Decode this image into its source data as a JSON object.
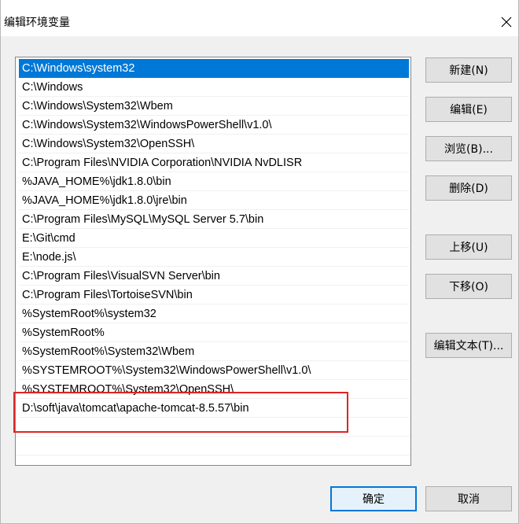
{
  "window": {
    "title": "编辑环境变量"
  },
  "path_list": {
    "items": [
      "C:\\Windows\\system32",
      "C:\\Windows",
      "C:\\Windows\\System32\\Wbem",
      "C:\\Windows\\System32\\WindowsPowerShell\\v1.0\\",
      "C:\\Windows\\System32\\OpenSSH\\",
      "C:\\Program Files\\NVIDIA Corporation\\NVIDIA NvDLISR",
      "%JAVA_HOME%\\jdk1.8.0\\bin",
      "%JAVA_HOME%\\jdk1.8.0\\jre\\bin",
      "C:\\Program Files\\MySQL\\MySQL Server 5.7\\bin",
      "E:\\Git\\cmd",
      "E:\\node.js\\",
      "C:\\Program Files\\VisualSVN Server\\bin",
      "C:\\Program Files\\TortoiseSVN\\bin",
      "%SystemRoot%\\system32",
      "%SystemRoot%",
      "%SystemRoot%\\System32\\Wbem",
      "%SYSTEMROOT%\\System32\\WindowsPowerShell\\v1.0\\",
      "%SYSTEMROOT%\\System32\\OpenSSH\\",
      "D:\\soft\\java\\tomcat\\apache-tomcat-8.5.57\\bin"
    ],
    "selected_index": 0
  },
  "buttons": {
    "new": "新建(N)",
    "edit": "编辑(E)",
    "browse": "浏览(B)...",
    "delete": "删除(D)",
    "move_up": "上移(U)",
    "move_down": "下移(O)",
    "edit_text": "编辑文本(T)...",
    "ok": "确定",
    "cancel": "取消"
  },
  "colors": {
    "selection": "#0078d7",
    "highlight_annotation": "#e02424"
  },
  "icons": {
    "close": "close-icon"
  }
}
